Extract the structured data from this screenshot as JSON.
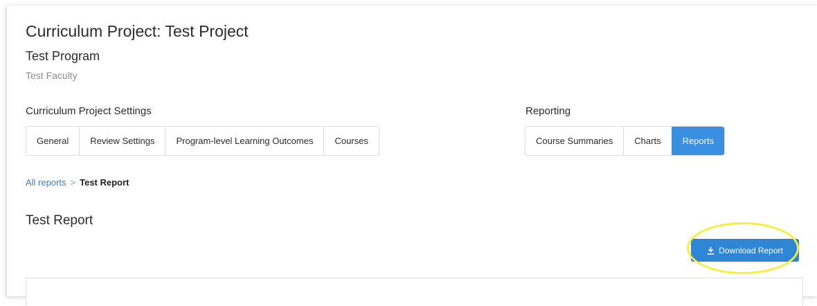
{
  "project": {
    "title": "Curriculum Project: Test Project",
    "program": "Test Program",
    "faculty": "Test Faculty"
  },
  "settings": {
    "label": "Curriculum Project Settings",
    "tabs": [
      {
        "label": "General"
      },
      {
        "label": "Review Settings"
      },
      {
        "label": "Program-level Learning Outcomes"
      },
      {
        "label": "Courses"
      }
    ]
  },
  "reporting": {
    "label": "Reporting",
    "tabs": [
      {
        "label": "Course Summaries"
      },
      {
        "label": "Charts"
      },
      {
        "label": "Reports",
        "active": true
      }
    ]
  },
  "breadcrumb": {
    "parent": "All reports",
    "separator": ">",
    "current": "Test Report"
  },
  "report": {
    "title": "Test Report",
    "download_label": "Download Report",
    "download_icon": "download-icon"
  },
  "colors": {
    "accent": "#3b8fe0",
    "button": "#2f86d4",
    "link": "#3b7ec8",
    "highlight": "#f5ee3d"
  }
}
